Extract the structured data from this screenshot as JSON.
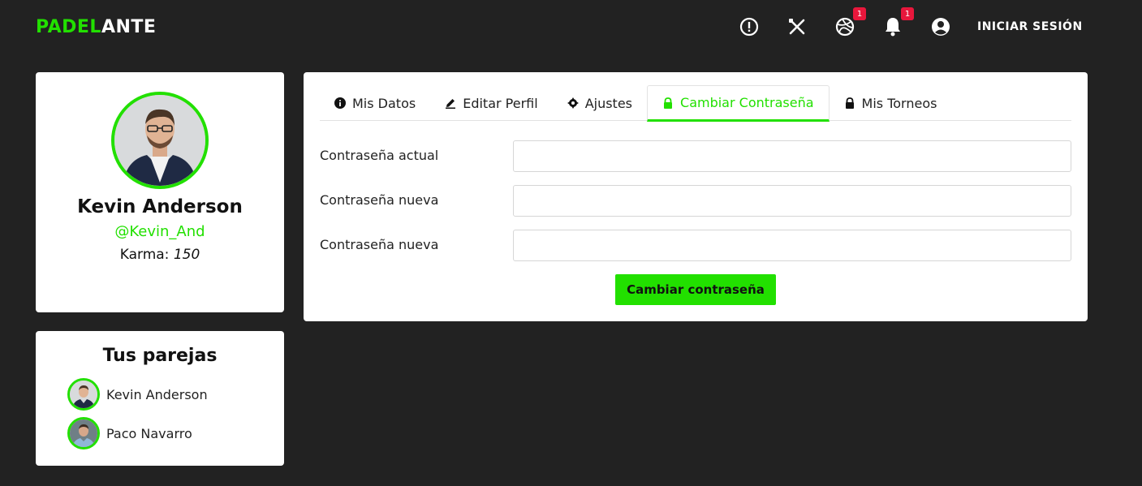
{
  "header": {
    "logo_part1": "PADEL",
    "logo_part2": "ANTE",
    "badge_tournaments": "1",
    "badge_notifications": "1",
    "login_label": "INICIAR SESIÓN",
    "accent_color": "#22e000"
  },
  "profile": {
    "name": "Kevin Anderson",
    "handle": "@Kevin_And",
    "karma_label": "Karma: ",
    "karma_value": "150"
  },
  "pairs": {
    "title": "Tus parejas",
    "items": [
      {
        "name": "Kevin Anderson"
      },
      {
        "name": "Paco Navarro"
      }
    ]
  },
  "tabs": [
    {
      "label": "Mis Datos",
      "icon": "info-icon"
    },
    {
      "label": "Editar Perfil",
      "icon": "pencil-icon"
    },
    {
      "label": "Ajustes",
      "icon": "gear-icon"
    },
    {
      "label": "Cambiar Contraseña",
      "icon": "lock-icon",
      "active": true
    },
    {
      "label": "Mis Torneos",
      "icon": "lock-icon"
    }
  ],
  "form": {
    "current_password_label": "Contraseña actual",
    "new_password_label": "Contraseña nueva",
    "confirm_password_label": "Contraseña nueva",
    "current_password_value": "",
    "new_password_value": "",
    "confirm_password_value": "",
    "submit_label": "Cambiar contraseña"
  }
}
